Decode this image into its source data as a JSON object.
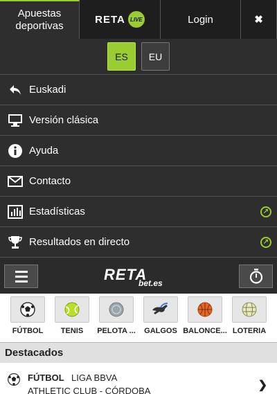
{
  "topbar": {
    "apuestas_line1": "Apuestas",
    "apuestas_line2": "deportivas",
    "reta": "RETA",
    "live": "LIVE",
    "login": "Login",
    "close": "✖"
  },
  "lang": {
    "es": "ES",
    "eu": "EU",
    "active": "ES"
  },
  "menu": {
    "items": [
      {
        "label": "Euskadi",
        "icon": "back-arrow-icon"
      },
      {
        "label": "Versión clásica",
        "icon": "monitor-icon"
      },
      {
        "label": "Ayuda",
        "icon": "info-icon"
      },
      {
        "label": "Contacto",
        "icon": "envelope-icon"
      },
      {
        "label": "Estadísticas",
        "icon": "bar-chart-icon",
        "external": true
      },
      {
        "label": "Resultados en directo",
        "icon": "trophy-icon",
        "external": true
      }
    ]
  },
  "logo": {
    "main": "RETA",
    "sub": "bet.es"
  },
  "sports": [
    {
      "label": "FÚTBOL",
      "icon": "soccer-ball-icon"
    },
    {
      "label": "TENIS",
      "icon": "tennis-ball-icon"
    },
    {
      "label": "PELOTA ...",
      "icon": "pelota-icon"
    },
    {
      "label": "GALGOS",
      "icon": "greyhound-icon"
    },
    {
      "label": "BALONCE...",
      "icon": "basketball-icon"
    },
    {
      "label": "LOTERIA",
      "icon": "lottery-ball-icon"
    }
  ],
  "destacados": {
    "title": "Destacados",
    "event": {
      "sport": "FÚTBOL",
      "league": "LIGA BBVA",
      "match": "ATHLETIC CLUB - CÓRDOBA"
    }
  },
  "colors": {
    "accent": "#9acd32",
    "dark": "#2b2b2b"
  }
}
